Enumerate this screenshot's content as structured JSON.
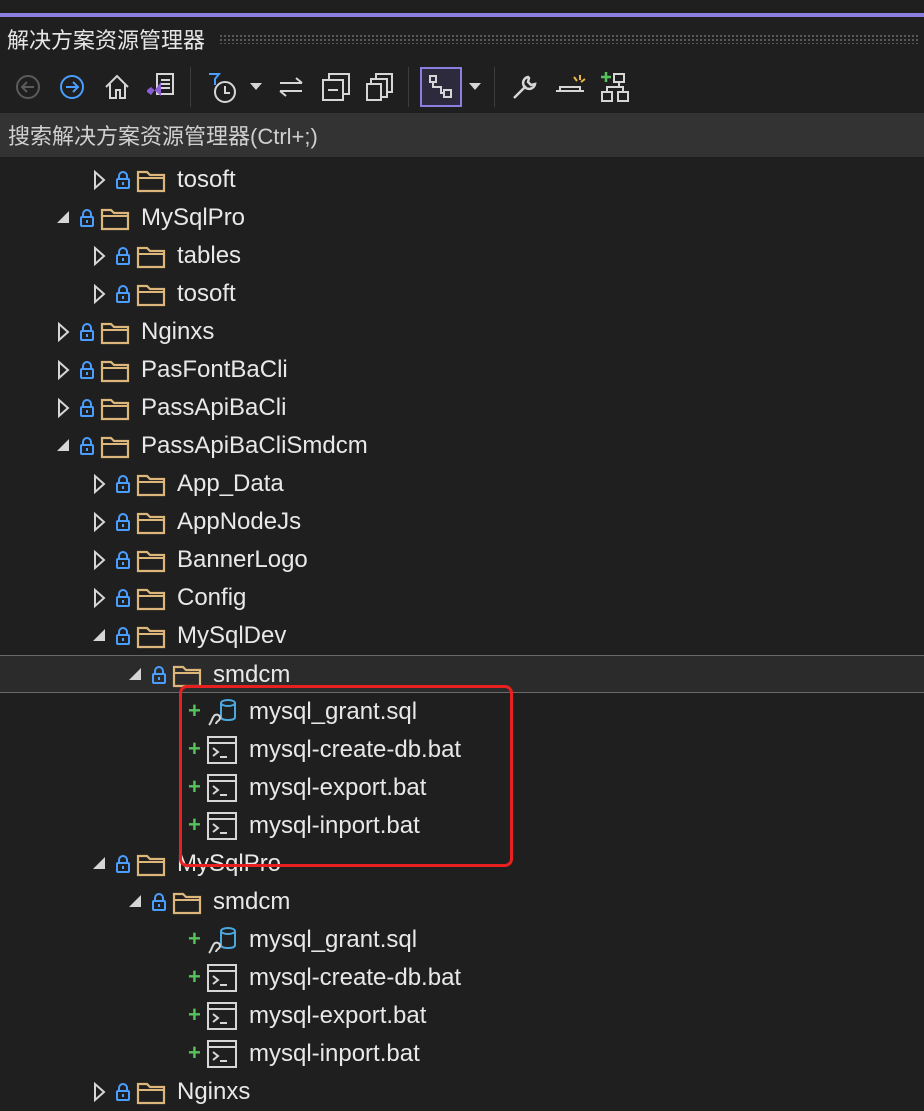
{
  "window": {
    "title": "解决方案资源管理器"
  },
  "toolbar": {
    "buttons": [
      {
        "name": "back-icon"
      },
      {
        "name": "forward-icon"
      },
      {
        "name": "home-icon"
      },
      {
        "name": "vs-solution-switch-icon"
      },
      {
        "name": "pending-changes-filter-icon"
      },
      {
        "name": "dropdown-arrow-icon"
      },
      {
        "name": "sync-with-document-icon"
      },
      {
        "name": "collapse-all-icon"
      },
      {
        "name": "show-all-files-icon"
      },
      {
        "name": "preview-selected-items-icon"
      },
      {
        "name": "dropdown-arrow-icon"
      },
      {
        "name": "properties-wrench-icon"
      },
      {
        "name": "pending-changes-icon"
      },
      {
        "name": "add-to-solution-icon"
      }
    ]
  },
  "search": {
    "placeholder": "搜索解决方案资源管理器(Ctrl+;)"
  },
  "tree": {
    "rows": [
      {
        "label": "tosoft",
        "type": "folder",
        "indent": 2,
        "expanded": false
      },
      {
        "label": "MySqlPro",
        "type": "folder",
        "indent": 1,
        "expanded": true
      },
      {
        "label": "tables",
        "type": "folder",
        "indent": 2,
        "expanded": false
      },
      {
        "label": "tosoft",
        "type": "folder",
        "indent": 2,
        "expanded": false
      },
      {
        "label": "Nginxs",
        "type": "folder",
        "indent": 1,
        "expanded": false
      },
      {
        "label": "PasFontBaCli",
        "type": "folder",
        "indent": 1,
        "expanded": false
      },
      {
        "label": "PassApiBaCli",
        "type": "folder",
        "indent": 1,
        "expanded": false
      },
      {
        "label": "PassApiBaCliSmdcm",
        "type": "folder",
        "indent": 1,
        "expanded": true
      },
      {
        "label": "App_Data",
        "type": "folder",
        "indent": 2,
        "expanded": false
      },
      {
        "label": "AppNodeJs",
        "type": "folder",
        "indent": 2,
        "expanded": false
      },
      {
        "label": "BannerLogo",
        "type": "folder",
        "indent": 2,
        "expanded": false
      },
      {
        "label": "Config",
        "type": "folder",
        "indent": 2,
        "expanded": false
      },
      {
        "label": "MySqlDev",
        "type": "folder",
        "indent": 2,
        "expanded": true
      },
      {
        "label": "smdcm",
        "type": "folder",
        "indent": 3,
        "expanded": true,
        "selected": true
      },
      {
        "label": "mysql_grant.sql",
        "type": "sql",
        "indent": 4
      },
      {
        "label": "mysql-create-db.bat",
        "type": "bat",
        "indent": 4
      },
      {
        "label": "mysql-export.bat",
        "type": "bat",
        "indent": 4
      },
      {
        "label": "mysql-inport.bat",
        "type": "bat",
        "indent": 4
      },
      {
        "label": "MySqlPro",
        "type": "folder",
        "indent": 2,
        "expanded": true
      },
      {
        "label": "smdcm",
        "type": "folder",
        "indent": 3,
        "expanded": true
      },
      {
        "label": "mysql_grant.sql",
        "type": "sql",
        "indent": 4
      },
      {
        "label": "mysql-create-db.bat",
        "type": "bat",
        "indent": 4
      },
      {
        "label": "mysql-export.bat",
        "type": "bat",
        "indent": 4
      },
      {
        "label": "mysql-inport.bat",
        "type": "bat",
        "indent": 4
      },
      {
        "label": "Nginxs",
        "type": "folder",
        "indent": 2,
        "expanded": false
      }
    ]
  },
  "colors": {
    "accent": "#8a7fe0",
    "highlight_box": "#e8201f",
    "folder": "#dcb67a",
    "lock": "#4a9eff",
    "added": "#57c15b"
  }
}
